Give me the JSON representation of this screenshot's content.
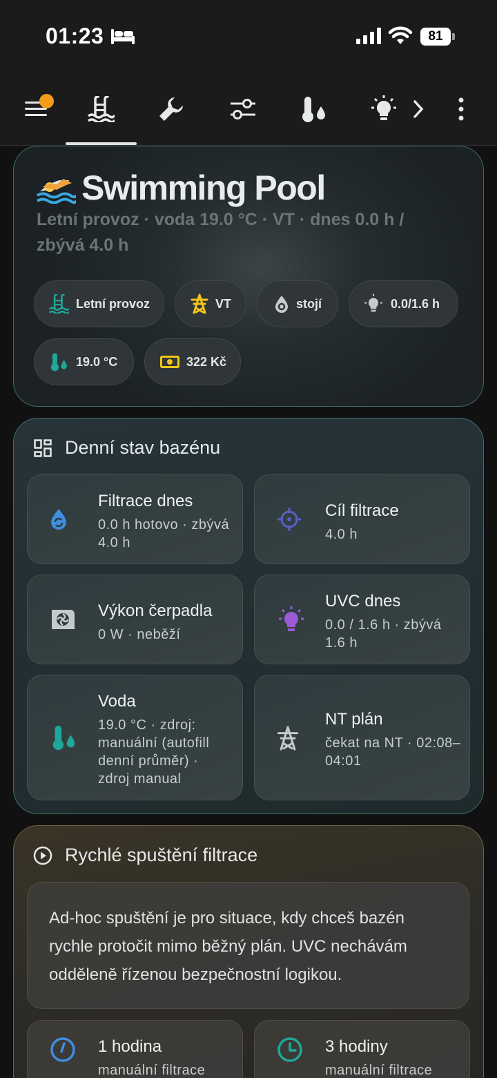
{
  "status_bar": {
    "time": "01:23",
    "battery": "81"
  },
  "tabs": [
    {
      "name": "menu",
      "icon": "hamburger-menu-icon"
    },
    {
      "name": "pool",
      "icon": "pool-icon",
      "active": true
    },
    {
      "name": "tools",
      "icon": "wrench-icon"
    },
    {
      "name": "settings",
      "icon": "sliders-icon"
    },
    {
      "name": "temperature",
      "icon": "thermometer-water-icon"
    },
    {
      "name": "light",
      "icon": "lightbulb-icon"
    },
    {
      "name": "more-tabs",
      "icon": "chevron-right-icon"
    },
    {
      "name": "overflow",
      "icon": "more-vertical-icon"
    }
  ],
  "hero": {
    "title": "Swimming Pool",
    "subtitle": "Letní provoz · voda 19.0 °C · VT · dnes 0.0 h / zbývá 4.0 h",
    "chips": [
      {
        "label": "Letní provoz",
        "icon": "pool-icon",
        "color": "#1fa89a"
      },
      {
        "label": "VT",
        "icon": "transmission-tower-icon",
        "color": "#f5c518"
      },
      {
        "label": "stojí",
        "icon": "water-sync-icon",
        "color": "#c5cacb"
      },
      {
        "label": "0.0/1.6 h",
        "icon": "lightbulb-icon",
        "color": "#c5cacb"
      },
      {
        "label": "19.0 °C",
        "icon": "thermometer-water-icon",
        "color": "#1fa89a"
      },
      {
        "label": "322 Kč",
        "icon": "cash-icon",
        "color": "#f5c518"
      }
    ]
  },
  "daily": {
    "title": "Denní stav bazénu",
    "tiles": [
      {
        "title": "Filtrace dnes",
        "sub": "0.0 h hotovo · zbývá 4.0 h",
        "icon": "water-sync-icon",
        "color": "#3e8fe0"
      },
      {
        "title": "Cíl filtrace",
        "sub": "4.0 h",
        "icon": "crosshairs-icon",
        "color": "#5660c8"
      },
      {
        "title": "Výkon čerpadla",
        "sub": "0 W · neběží",
        "icon": "pump-icon",
        "color": "#c5cacb"
      },
      {
        "title": "UVC dnes",
        "sub": "0.0 / 1.6 h · zbývá 1.6 h",
        "icon": "lightbulb-icon",
        "color": "#9b5bd6"
      },
      {
        "title": "Voda",
        "sub": "19.0 °C · zdroj: manuální (autofill denní průměr) · zdroj manual",
        "icon": "thermometer-water-icon",
        "color": "#1fa89a"
      },
      {
        "title": "NT plán",
        "sub": "čekat na NT · 02:08–04:01",
        "icon": "transmission-tower-icon",
        "color": "#c5cacb"
      }
    ]
  },
  "quick": {
    "title": "Rychlé spuštění filtrace",
    "info": "Ad-hoc spuštění je pro situace, kdy chceš bazén rychle protočit mimo běžný plán. UVC nechávám odděleně řízenou bezpečnostní logikou.",
    "buttons": [
      {
        "title": "1 hodina",
        "sub": "manuální filtrace",
        "icon": "clock-icon",
        "color": "#3e8fe0"
      },
      {
        "title": "3 hodiny",
        "sub": "manuální filtrace",
        "icon": "clock-icon",
        "color": "#1fa89a"
      }
    ]
  }
}
